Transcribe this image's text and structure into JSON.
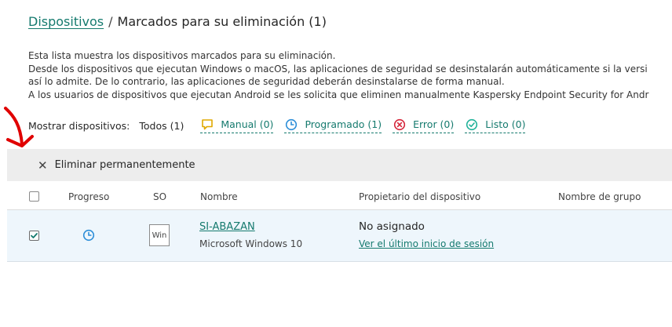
{
  "breadcrumb": {
    "parent": "Dispositivos",
    "separator": "/",
    "current": "Marcados para su eliminación (1)"
  },
  "description": {
    "lines": [
      "Esta lista muestra los dispositivos marcados para su eliminación.",
      "Desde los dispositivos que ejecutan Windows o macOS, las aplicaciones de seguridad se desinstalarán automáticamente si la versi",
      "así lo admite. De lo contrario, las aplicaciones de seguridad deberán desinstalarse de forma manual.",
      "A los usuarios de dispositivos que ejecutan Android se les solicita que eliminen manualmente Kaspersky Endpoint Security for Andr"
    ]
  },
  "filters": {
    "label": "Mostrar dispositivos:",
    "all": "Todos (1)",
    "items": [
      {
        "label": "Manual (0)",
        "icon": "comment-icon",
        "color": "#e0a800"
      },
      {
        "label": "Programado (1)",
        "icon": "clock-icon",
        "color": "#2d8ed8"
      },
      {
        "label": "Error (0)",
        "icon": "error-icon",
        "color": "#d6263b"
      },
      {
        "label": "Listo (0)",
        "icon": "check-circle-icon",
        "color": "#21b29a"
      }
    ]
  },
  "toolbar": {
    "delete_label": "Eliminar permanentemente",
    "delete_icon": "close-icon"
  },
  "table": {
    "columns": [
      "Progreso",
      "SO",
      "Nombre",
      "Propietario del dispositivo",
      "Nombre de grupo"
    ],
    "rows": [
      {
        "checked": true,
        "progress_icon": "clock-icon",
        "os_badge": "Win",
        "name": "SI-ABAZAN",
        "os": "Microsoft Windows 10",
        "owner": "No asignado",
        "owner_link": "Ver el último inicio de sesión",
        "group": ""
      }
    ]
  },
  "annotation": {
    "color": "#e00000",
    "icon": "red-arrow-annotation"
  },
  "colors": {
    "accent": "#157a6e",
    "toolbar_bg": "#ededed",
    "row_selected_bg": "#eef6fc"
  }
}
